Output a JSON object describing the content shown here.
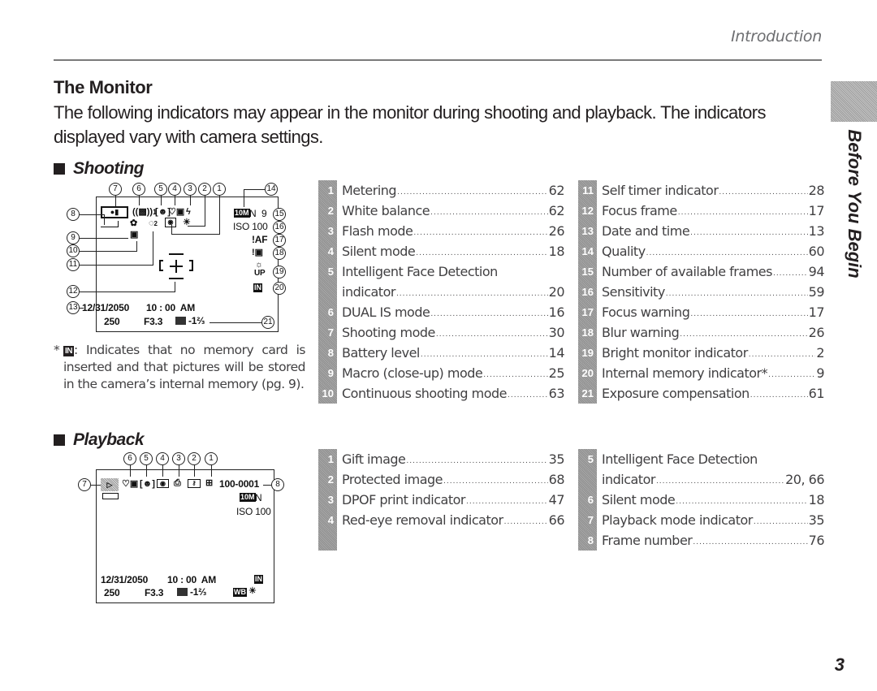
{
  "running_head": "Introduction",
  "side_label": "Before You Begin",
  "title": "The Monitor",
  "intro": "The following indicators may appear in the monitor during shooting and playback. The indicators displayed vary with camera settings.",
  "page_number": "3",
  "shooting": {
    "heading": "Shooting",
    "display": {
      "date": "12/31/2050",
      "time": "10 : 00  AM",
      "shutter": "250",
      "aperture": "F3.3",
      "exposure_comp": "-1⅔",
      "quality_badge": "10M",
      "quality_letter": "N",
      "frames": "9",
      "iso": "ISO 100",
      "focus_warning": "!AF",
      "bright_up": "UP",
      "internal_badge": "IN",
      "dual_is_suffix": "1",
      "self_timer_suffix": "2"
    },
    "callouts": [
      "1",
      "2",
      "3",
      "4",
      "5",
      "6",
      "7",
      "8",
      "9",
      "10",
      "11",
      "12",
      "13",
      "14",
      "15",
      "16",
      "17",
      "18",
      "19",
      "20",
      "21"
    ],
    "footnote": {
      "marker": "*",
      "badge": "IN",
      "text": ": Indicates that no memory card is inserted and that pictures will be stored in the camera’s internal memory (pg. 9)."
    },
    "index_left": [
      {
        "num": "1",
        "label": "Metering",
        "page": "62"
      },
      {
        "num": "2",
        "label": "White balance",
        "page": "62"
      },
      {
        "num": "3",
        "label": "Flash mode",
        "page": "26"
      },
      {
        "num": "4",
        "label": "Silent mode",
        "page": "18"
      },
      {
        "num": "5",
        "label": "Intelligent Face Detection",
        "page": ""
      },
      {
        "num": "",
        "label": "indicator",
        "page": "20"
      },
      {
        "num": "6",
        "label": "DUAL IS mode",
        "page": "16"
      },
      {
        "num": "7",
        "label": "Shooting mode",
        "page": "30"
      },
      {
        "num": "8",
        "label": "Battery level",
        "page": "14"
      },
      {
        "num": "9",
        "label": "Macro (close-up) mode",
        "page": "25"
      },
      {
        "num": "10",
        "label": "Continuous shooting mode",
        "page": "63"
      }
    ],
    "index_right": [
      {
        "num": "11",
        "label": "Self timer indicator",
        "page": "28"
      },
      {
        "num": "12",
        "label": "Focus frame",
        "page": "17"
      },
      {
        "num": "13",
        "label": "Date and time",
        "page": "13"
      },
      {
        "num": "14",
        "label": "Quality",
        "page": "60"
      },
      {
        "num": "15",
        "label": "Number of available frames",
        "page": "94"
      },
      {
        "num": "16",
        "label": "Sensitivity",
        "page": "59"
      },
      {
        "num": "17",
        "label": "Focus warning",
        "page": "17"
      },
      {
        "num": "18",
        "label": "Blur warning",
        "page": "26"
      },
      {
        "num": "19",
        "label": "Bright monitor indicator",
        "page": "2"
      },
      {
        "num": "20",
        "label": "Internal memory indicator*",
        "page": "9"
      },
      {
        "num": "21",
        "label": "Exposure compensation",
        "page": "61"
      }
    ]
  },
  "playback": {
    "heading": "Playback",
    "display": {
      "frame_number": "100-0001",
      "quality_badge": "10M",
      "quality_letter": "N",
      "iso": "ISO 100",
      "date": "12/31/2050",
      "time": "10 : 00  AM",
      "shutter": "250",
      "aperture": "F3.3",
      "exposure_comp": "-1⅔",
      "internal_badge": "IN",
      "wb_badge": "WB"
    },
    "callouts": [
      "1",
      "2",
      "3",
      "4",
      "5",
      "6",
      "7",
      "8"
    ],
    "index_left": [
      {
        "num": "1",
        "label": "Gift image",
        "page": "35"
      },
      {
        "num": "2",
        "label": "Protected image",
        "page": "68"
      },
      {
        "num": "3",
        "label": "DPOF print indicator",
        "page": "47"
      },
      {
        "num": "4",
        "label": "Red-eye removal indicator",
        "page": "66"
      },
      {
        "num": "",
        "label": "",
        "page": ""
      }
    ],
    "index_right": [
      {
        "num": "5",
        "label": "Intelligent Face Detection",
        "page": ""
      },
      {
        "num": "",
        "label": "indicator",
        "page": "20, 66"
      },
      {
        "num": "6",
        "label": "Silent mode",
        "page": "18"
      },
      {
        "num": "7",
        "label": "Playback mode indicator",
        "page": "35"
      },
      {
        "num": "8",
        "label": "Frame number",
        "page": "76"
      }
    ]
  }
}
